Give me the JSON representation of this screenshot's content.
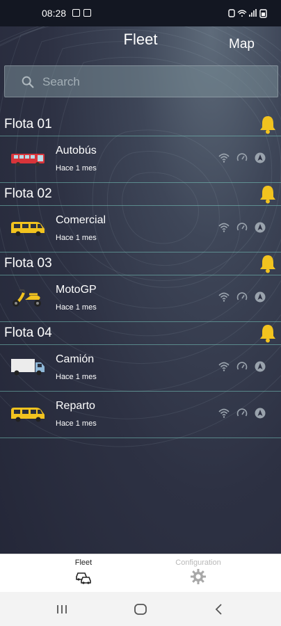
{
  "status_bar": {
    "time": "08:28"
  },
  "header": {
    "title": "Fleet",
    "map_label": "Map"
  },
  "search": {
    "placeholder": "Search",
    "value": ""
  },
  "fleets": [
    {
      "name": "Flota 01",
      "alert_icon": "bell-icon",
      "vehicles": [
        {
          "name": "Autobús",
          "last_seen": "Hace 1 mes",
          "icon": "bus-icon",
          "color": "#d8343a"
        }
      ]
    },
    {
      "name": "Flota 02",
      "alert_icon": "bell-icon",
      "vehicles": [
        {
          "name": "Comercial",
          "last_seen": "Hace 1 mes",
          "icon": "van-icon",
          "color": "#f2c31f"
        }
      ]
    },
    {
      "name": "Flota 03",
      "alert_icon": "bell-icon",
      "vehicles": [
        {
          "name": "MotoGP",
          "last_seen": "Hace 1 mes",
          "icon": "scooter-icon",
          "color": "#f2c31f"
        }
      ]
    },
    {
      "name": "Flota 04",
      "alert_icon": "bell-icon",
      "vehicles": [
        {
          "name": "Camión",
          "last_seen": "Hace 1 mes",
          "icon": "truck-icon",
          "color": "#e8e8e8"
        },
        {
          "name": "Reparto",
          "last_seen": "Hace 1 mes",
          "icon": "van-icon",
          "color": "#f2c31f"
        }
      ]
    }
  ],
  "tabs": [
    {
      "label": "Fleet",
      "icon": "cars-icon",
      "active": true
    },
    {
      "label": "Configuration",
      "icon": "gear-icon",
      "active": false
    }
  ],
  "colors": {
    "bell": "#f2c31f",
    "separator": "#78c8be",
    "tab_inactive": "#b8b8b8"
  }
}
